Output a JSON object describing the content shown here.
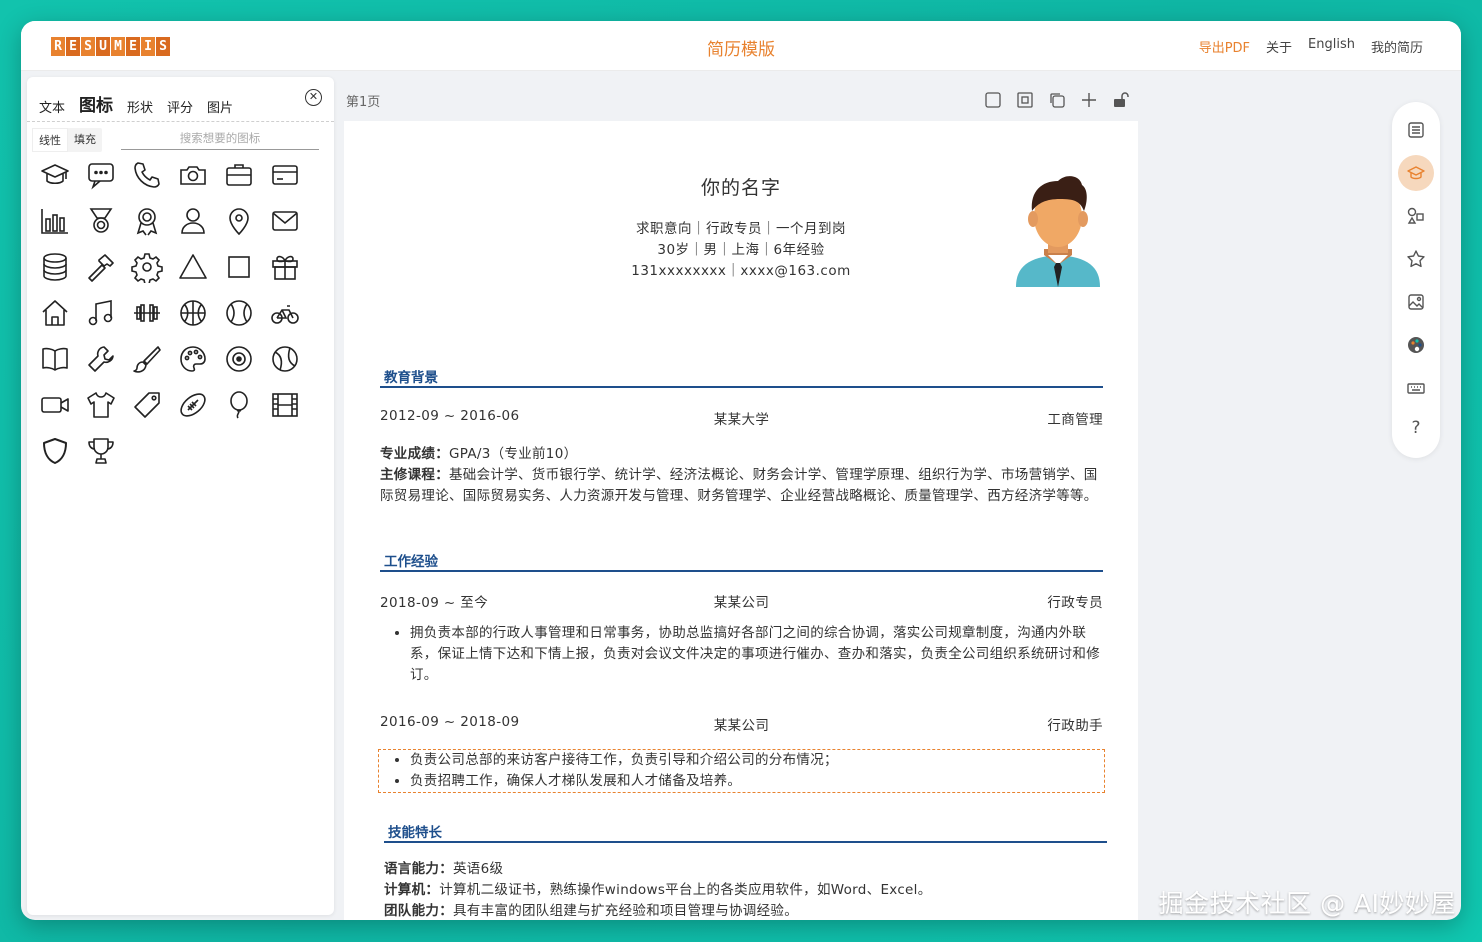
{
  "header": {
    "logo_letters": [
      "R",
      "E",
      "S",
      "U",
      "M",
      "E",
      "I",
      "S"
    ],
    "title": "简历模版",
    "nav": {
      "export": "导出PDF",
      "about": "关于",
      "english": "English",
      "mine": "我的简历"
    }
  },
  "panel": {
    "tabs": {
      "text": "文本",
      "icon": "图标",
      "shape": "形状",
      "rating": "评分",
      "image": "图片"
    },
    "seg": {
      "line": "线性",
      "fill": "填充"
    },
    "search_placeholder": "搜索想要的图标"
  },
  "canvas": {
    "page_label": "第1页"
  },
  "resume": {
    "name": "你的名字",
    "line1": "求职意向｜行政专员｜一个月到岗",
    "line2": "30岁｜男｜上海｜6年经验",
    "line3": "131xxxxxxxx｜xxxx@163.com",
    "edu": {
      "title": "教育背景",
      "date": "2012-09 ~ 2016-06",
      "school": "某某大学",
      "major": "工商管理",
      "score_label": "专业成绩：",
      "score": "GPA/3（专业前10）",
      "courses_label": "主修课程：",
      "courses": "基础会计学、货币银行学、统计学、经济法概论、财务会计学、管理学原理、组织行为学、市场营销学、国际贸易理论、国际贸易实务、人力资源开发与管理、财务管理学、企业经营战略概论、质量管理学、西方经济学等等。"
    },
    "work": {
      "title": "工作经验",
      "job1": {
        "date": "2018-09 ~ 至今",
        "company": "某某公司",
        "role": "行政专员",
        "bullets": [
          "拥负责本部的行政人事管理和日常事务，协助总监搞好各部门之间的综合协调，落实公司规章制度，沟通内外联系，保证上情下达和下情上报，负责对会议文件决定的事项进行催办、查办和落实，负责全公司组织系统研讨和修订。"
        ]
      },
      "job2": {
        "date": "2016-09 ~ 2018-09",
        "company": "某某公司",
        "role": "行政助手",
        "bullets": [
          "负责公司总部的来访客户接待工作，负责引导和介绍公司的分布情况；",
          "负责招聘工作，确保人才梯队发展和人才储备及培养。"
        ]
      }
    },
    "skills": {
      "title": "技能特长",
      "lang_label": "语言能力：",
      "lang": "英语6级",
      "pc_label": "计算机：",
      "pc": "计算机二级证书，熟练操作windows平台上的各类应用软件，如Word、Excel。",
      "team_label": "团队能力：",
      "team": "具有丰富的团队组建与扩充经验和项目管理与协调经验。"
    }
  },
  "rail": {
    "help": "?"
  },
  "watermark": "掘金技术社区 @ AI妙妙屋",
  "colors": {
    "accent": "#e8822f",
    "section": "#1e4f8c",
    "teal_bg": "#12c3ad"
  }
}
